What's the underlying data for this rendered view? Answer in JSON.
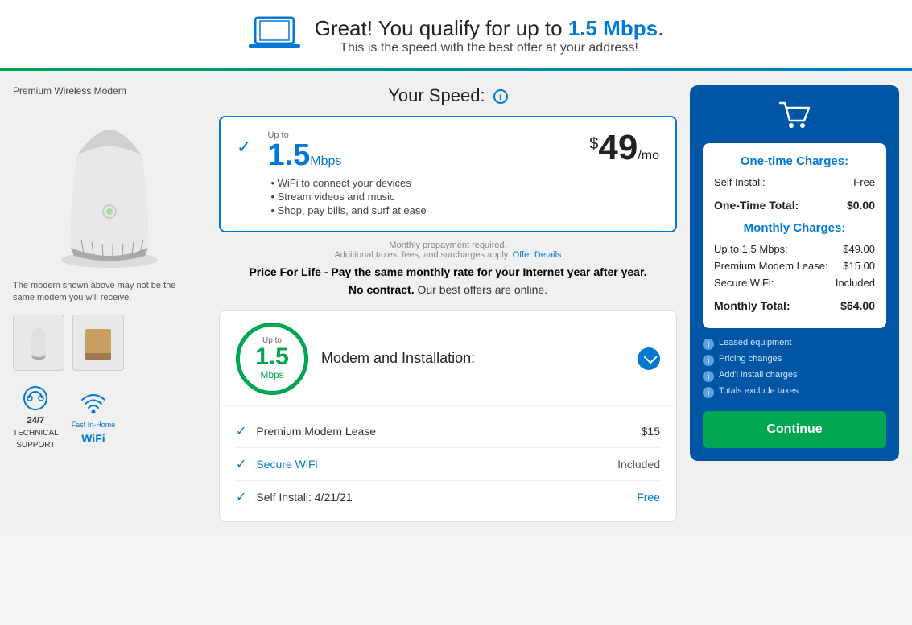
{
  "header": {
    "title_part1": "Great! You qualify for up to ",
    "title_accent": "1.5 Mbps",
    "title_end": ".",
    "subtitle": "This is the speed with the best offer at your address!"
  },
  "left": {
    "modem_label": "Premium Wireless Modem",
    "modem_disclaimer": "The modem shown above may not be the same modem you will receive.",
    "badge_support_line1": "24/7",
    "badge_support_line2": "TECHNICAL",
    "badge_support_line3": "SUPPORT",
    "badge_wifi_line1": "Fast In-Home",
    "badge_wifi_line2": "WiFi"
  },
  "center": {
    "speed_title": "Your Speed:",
    "up_to_label": "Up to",
    "speed_value": "1.5",
    "speed_unit": "Mbps",
    "price_dollar": "$",
    "price_amount": "49",
    "price_per": "/mo",
    "bullets": [
      "WiFi to connect your devices",
      "Stream videos and music",
      "Shop, pay bills, and surf at ease"
    ],
    "prepayment_note": "Monthly prepayment required.",
    "tax_note": "Additional taxes, fees, and surcharges apply.",
    "offer_details_link": "Offer Details",
    "price_for_life_text": "Price For Life - Pay the same monthly rate for your Internet year after year.",
    "no_contract": "No contract.",
    "no_contract_rest": " Our best offers are online.",
    "circle_up_to": "Up to",
    "circle_speed": "1.5",
    "circle_unit": "Mbps",
    "section_title": "Modem and Installation:",
    "items": [
      {
        "label": "Premium Modem Lease",
        "price": "$15",
        "is_link": false,
        "price_type": "normal"
      },
      {
        "label": "Secure WiFi",
        "price": "Included",
        "is_link": true,
        "price_type": "included"
      },
      {
        "label": "Self Install: 4/21/21",
        "price": "Free",
        "is_link": false,
        "price_type": "free"
      }
    ]
  },
  "right": {
    "one_time_title": "One-time Charges:",
    "self_install_label": "Self Install:",
    "self_install_value": "Free",
    "one_time_total_label": "One-Time Total:",
    "one_time_total_value": "$0.00",
    "monthly_title": "Monthly Charges:",
    "monthly_items": [
      {
        "label": "Up to 1.5 Mbps:",
        "value": "$49.00"
      },
      {
        "label": "Premium Modem Lease:",
        "value": "$15.00"
      },
      {
        "label": "Secure WiFi:",
        "value": "Included"
      }
    ],
    "monthly_total_label": "Monthly Total:",
    "monthly_total_value": "$64.00",
    "notes": [
      "Leased equipment",
      "Pricing changes",
      "Add'l install charges",
      "Totals exclude taxes"
    ],
    "continue_label": "Continue"
  }
}
